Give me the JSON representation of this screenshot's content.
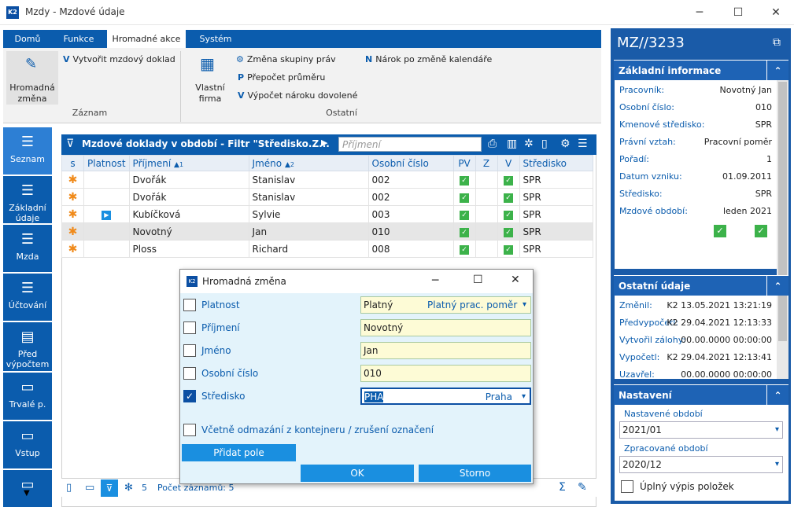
{
  "window": {
    "title": "Mzdy - Mzdové údaje",
    "icon_text": "K2"
  },
  "ribbon_tabs": [
    "Domů",
    "Funkce",
    "Hromadné akce",
    "Systém"
  ],
  "ribbon": {
    "hromadna_zmena": "Hromadná změna",
    "vytvorit": "Vytvořit mzdový doklad",
    "group_zaznam": "Záznam",
    "vlastni_firma": "Vlastní firma",
    "zmena_skupiny": "Změna skupiny práv",
    "prepocet": "Přepočet průměru",
    "vypocet_naroku": "Výpočet nároku dovolené",
    "narok_po_zmene": "Nárok po změně kalendáře",
    "group_ostatni": "Ostatní"
  },
  "nav": [
    "Seznam",
    "Základní údaje",
    "Mzda",
    "Účtování",
    "Před výpočtem",
    "Trvalé p.",
    "Vstup"
  ],
  "grid": {
    "title": "Mzdové doklady v období - Filtr \"Středisko.Z...",
    "search_placeholder": "Příjmení",
    "columns": [
      "s",
      "Platnost",
      "Příjmení",
      "Jméno",
      "Osobní číslo",
      "PV",
      "Z",
      "V",
      "Středisko"
    ],
    "sort1": "1",
    "sort2": "2",
    "rows": [
      {
        "prijmeni": "Dvořák",
        "jmeno": "Stanislav",
        "cislo": "002",
        "stredisko": "SPR"
      },
      {
        "prijmeni": "Dvořák",
        "jmeno": "Stanislav",
        "cislo": "002",
        "stredisko": "SPR"
      },
      {
        "prijmeni": "Kubíčková",
        "jmeno": "Sylvie",
        "cislo": "003",
        "stredisko": "SPR"
      },
      {
        "prijmeni": "Novotný",
        "jmeno": "Jan",
        "cislo": "010",
        "stredisko": "SPR"
      },
      {
        "prijmeni": "Ploss",
        "jmeno": "Richard",
        "cislo": "008",
        "stredisko": "SPR"
      }
    ],
    "status_count": "5",
    "status_text": "Počet záznamů: 5"
  },
  "right": {
    "title": "MZ//3233",
    "zakladni": {
      "head": "Základní informace",
      "rows": [
        {
          "k": "Pracovník:",
          "v": "Novotný Jan"
        },
        {
          "k": "Osobní číslo:",
          "v": "010"
        },
        {
          "k": "Kmenové středisko:",
          "v": "SPR"
        },
        {
          "k": "Právní vztah:",
          "v": "Pracovní poměr"
        },
        {
          "k": "Pořadí:",
          "v": "1"
        },
        {
          "k": "Datum vzniku:",
          "v": "01.09.2011"
        },
        {
          "k": "Středisko:",
          "v": "SPR"
        },
        {
          "k": "Mzdové období:",
          "v": "leden 2021"
        }
      ]
    },
    "ostatni": {
      "head": "Ostatní údaje",
      "rows": [
        {
          "k": "Změnil:",
          "v": "K2 13.05.2021 13:21:19"
        },
        {
          "k": "Předvypočetl:",
          "v": "K2 29.04.2021 12:13:33"
        },
        {
          "k": "Vytvořil zálohy:",
          "v": "00.00.0000 00:00:00"
        },
        {
          "k": "Vypočetl:",
          "v": "K2 29.04.2021 12:13:41"
        },
        {
          "k": "Uzavřel:",
          "v": "00.00.0000 00:00:00"
        }
      ]
    },
    "nastaveni": {
      "head": "Nastavení",
      "nastavene_label": "Nastavené období",
      "nastavene_value": "2021/01",
      "zpracovane_label": "Zpracované období",
      "zpracovane_value": "2020/12",
      "uplny": "Úplný výpis položek"
    }
  },
  "dialog": {
    "title": "Hromadná změna",
    "fields": [
      {
        "label": "Platnost",
        "value": "Platný",
        "extra": "Platný prac. poměr",
        "checked": false
      },
      {
        "label": "Příjmení",
        "value": "Novotný",
        "extra": "",
        "checked": false
      },
      {
        "label": "Jméno",
        "value": "Jan",
        "extra": "",
        "checked": false
      },
      {
        "label": "Osobní číslo",
        "value": "010",
        "extra": "",
        "checked": false
      },
      {
        "label": "Středisko",
        "value": "PHA",
        "extra": "Praha",
        "checked": true
      }
    ],
    "include_label": "Včetně odmazání z kontejneru / zrušení označení",
    "add_field": "Přidat pole",
    "ok": "OK",
    "cancel": "Storno"
  }
}
